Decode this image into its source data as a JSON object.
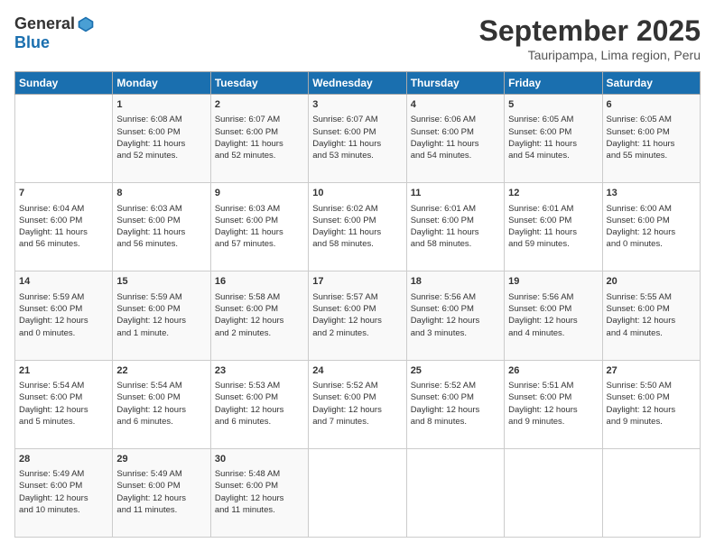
{
  "header": {
    "logo_general": "General",
    "logo_blue": "Blue",
    "month_title": "September 2025",
    "location": "Tauripampa, Lima region, Peru"
  },
  "days_of_week": [
    "Sunday",
    "Monday",
    "Tuesday",
    "Wednesday",
    "Thursday",
    "Friday",
    "Saturday"
  ],
  "weeks": [
    [
      {
        "day": "",
        "info": ""
      },
      {
        "day": "1",
        "info": "Sunrise: 6:08 AM\nSunset: 6:00 PM\nDaylight: 11 hours\nand 52 minutes."
      },
      {
        "day": "2",
        "info": "Sunrise: 6:07 AM\nSunset: 6:00 PM\nDaylight: 11 hours\nand 52 minutes."
      },
      {
        "day": "3",
        "info": "Sunrise: 6:07 AM\nSunset: 6:00 PM\nDaylight: 11 hours\nand 53 minutes."
      },
      {
        "day": "4",
        "info": "Sunrise: 6:06 AM\nSunset: 6:00 PM\nDaylight: 11 hours\nand 54 minutes."
      },
      {
        "day": "5",
        "info": "Sunrise: 6:05 AM\nSunset: 6:00 PM\nDaylight: 11 hours\nand 54 minutes."
      },
      {
        "day": "6",
        "info": "Sunrise: 6:05 AM\nSunset: 6:00 PM\nDaylight: 11 hours\nand 55 minutes."
      }
    ],
    [
      {
        "day": "7",
        "info": "Sunrise: 6:04 AM\nSunset: 6:00 PM\nDaylight: 11 hours\nand 56 minutes."
      },
      {
        "day": "8",
        "info": "Sunrise: 6:03 AM\nSunset: 6:00 PM\nDaylight: 11 hours\nand 56 minutes."
      },
      {
        "day": "9",
        "info": "Sunrise: 6:03 AM\nSunset: 6:00 PM\nDaylight: 11 hours\nand 57 minutes."
      },
      {
        "day": "10",
        "info": "Sunrise: 6:02 AM\nSunset: 6:00 PM\nDaylight: 11 hours\nand 58 minutes."
      },
      {
        "day": "11",
        "info": "Sunrise: 6:01 AM\nSunset: 6:00 PM\nDaylight: 11 hours\nand 58 minutes."
      },
      {
        "day": "12",
        "info": "Sunrise: 6:01 AM\nSunset: 6:00 PM\nDaylight: 11 hours\nand 59 minutes."
      },
      {
        "day": "13",
        "info": "Sunrise: 6:00 AM\nSunset: 6:00 PM\nDaylight: 12 hours\nand 0 minutes."
      }
    ],
    [
      {
        "day": "14",
        "info": "Sunrise: 5:59 AM\nSunset: 6:00 PM\nDaylight: 12 hours\nand 0 minutes."
      },
      {
        "day": "15",
        "info": "Sunrise: 5:59 AM\nSunset: 6:00 PM\nDaylight: 12 hours\nand 1 minute."
      },
      {
        "day": "16",
        "info": "Sunrise: 5:58 AM\nSunset: 6:00 PM\nDaylight: 12 hours\nand 2 minutes."
      },
      {
        "day": "17",
        "info": "Sunrise: 5:57 AM\nSunset: 6:00 PM\nDaylight: 12 hours\nand 2 minutes."
      },
      {
        "day": "18",
        "info": "Sunrise: 5:56 AM\nSunset: 6:00 PM\nDaylight: 12 hours\nand 3 minutes."
      },
      {
        "day": "19",
        "info": "Sunrise: 5:56 AM\nSunset: 6:00 PM\nDaylight: 12 hours\nand 4 minutes."
      },
      {
        "day": "20",
        "info": "Sunrise: 5:55 AM\nSunset: 6:00 PM\nDaylight: 12 hours\nand 4 minutes."
      }
    ],
    [
      {
        "day": "21",
        "info": "Sunrise: 5:54 AM\nSunset: 6:00 PM\nDaylight: 12 hours\nand 5 minutes."
      },
      {
        "day": "22",
        "info": "Sunrise: 5:54 AM\nSunset: 6:00 PM\nDaylight: 12 hours\nand 6 minutes."
      },
      {
        "day": "23",
        "info": "Sunrise: 5:53 AM\nSunset: 6:00 PM\nDaylight: 12 hours\nand 6 minutes."
      },
      {
        "day": "24",
        "info": "Sunrise: 5:52 AM\nSunset: 6:00 PM\nDaylight: 12 hours\nand 7 minutes."
      },
      {
        "day": "25",
        "info": "Sunrise: 5:52 AM\nSunset: 6:00 PM\nDaylight: 12 hours\nand 8 minutes."
      },
      {
        "day": "26",
        "info": "Sunrise: 5:51 AM\nSunset: 6:00 PM\nDaylight: 12 hours\nand 9 minutes."
      },
      {
        "day": "27",
        "info": "Sunrise: 5:50 AM\nSunset: 6:00 PM\nDaylight: 12 hours\nand 9 minutes."
      }
    ],
    [
      {
        "day": "28",
        "info": "Sunrise: 5:49 AM\nSunset: 6:00 PM\nDaylight: 12 hours\nand 10 minutes."
      },
      {
        "day": "29",
        "info": "Sunrise: 5:49 AM\nSunset: 6:00 PM\nDaylight: 12 hours\nand 11 minutes."
      },
      {
        "day": "30",
        "info": "Sunrise: 5:48 AM\nSunset: 6:00 PM\nDaylight: 12 hours\nand 11 minutes."
      },
      {
        "day": "",
        "info": ""
      },
      {
        "day": "",
        "info": ""
      },
      {
        "day": "",
        "info": ""
      },
      {
        "day": "",
        "info": ""
      }
    ]
  ]
}
